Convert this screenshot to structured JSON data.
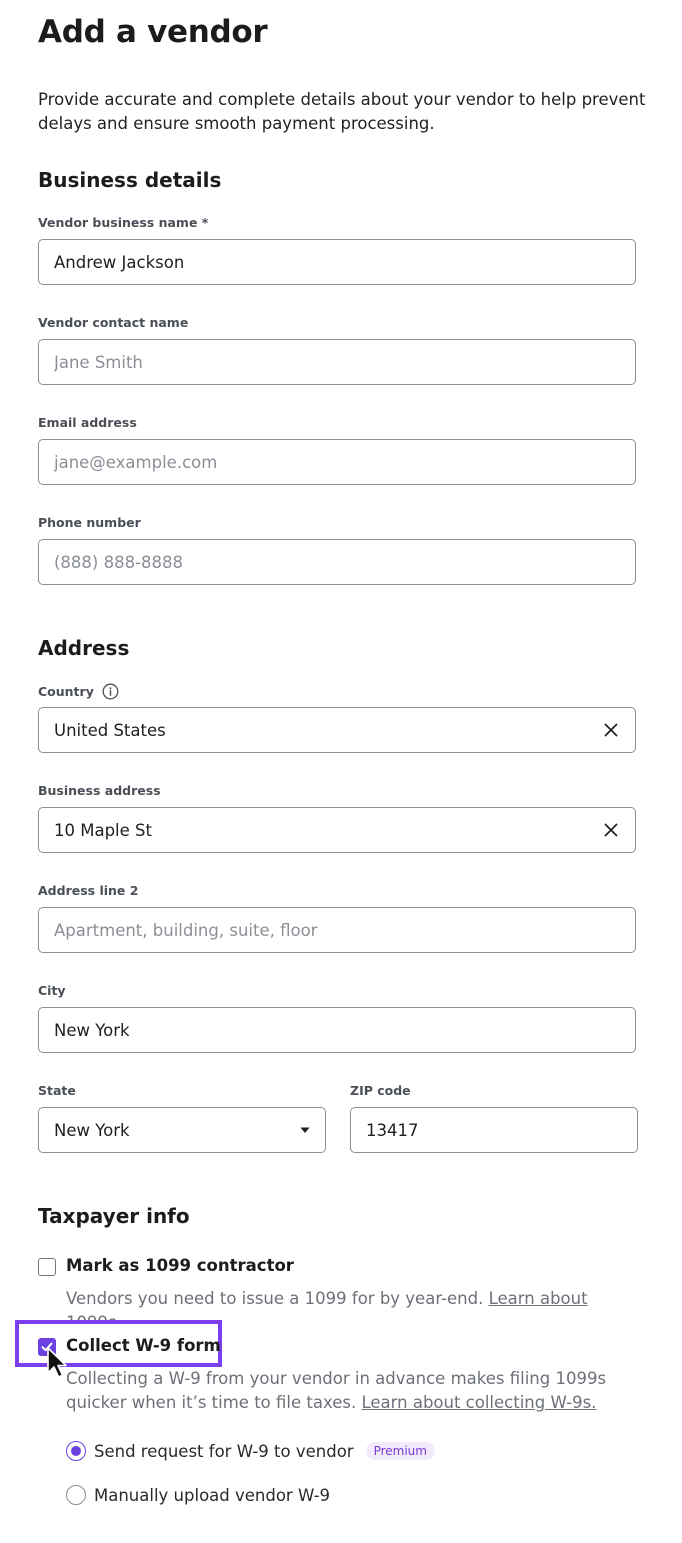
{
  "page": {
    "title": "Add a vendor",
    "intro": "Provide accurate and complete details about your vendor to help prevent delays and ensure smooth payment processing."
  },
  "business": {
    "heading": "Business details",
    "name_label": "Vendor business name *",
    "name_value": "Andrew Jackson",
    "contact_label": "Vendor contact name",
    "contact_placeholder": "Jane Smith",
    "email_label": "Email address",
    "email_placeholder": "jane@example.com",
    "phone_label": "Phone number",
    "phone_placeholder": "(888) 888-8888"
  },
  "address": {
    "heading": "Address",
    "country_label": "Country",
    "country_value": "United States",
    "street_label": "Business address",
    "street_value": "10 Maple St",
    "line2_label": "Address line 2",
    "line2_placeholder": "Apartment, building, suite, floor",
    "city_label": "City",
    "city_value": "New York",
    "state_label": "State",
    "state_value": "New York",
    "zip_label": "ZIP code",
    "zip_value": "13417"
  },
  "taxpayer": {
    "heading": "Taxpayer info",
    "contractor_label": "Mark as 1099 contractor",
    "contractor_checked": false,
    "contractor_help": "Vendors you need to issue a 1099 for by year-end.",
    "contractor_link": "Learn about 1099s.",
    "w9_label": "Collect W-9 form",
    "w9_checked": true,
    "w9_help": "Collecting a W-9 from your vendor in advance makes filing 1099s quicker when it’s time to file taxes.",
    "w9_link": "Learn about collecting W-9s.",
    "option_send": "Send request for W-9 to vendor",
    "option_send_badge": "Premium",
    "option_upload": "Manually upload vendor W-9",
    "selected_option": "send"
  },
  "colors": {
    "accent": "#6b3fe0",
    "highlight": "#7b3fef",
    "badge_bg": "#f1ebfb"
  },
  "icons": {
    "country_info": "info-circle-icon",
    "clear": "close-x-icon",
    "state_dropdown": "caret-down-icon",
    "cursor": "mouse-pointer-icon"
  }
}
